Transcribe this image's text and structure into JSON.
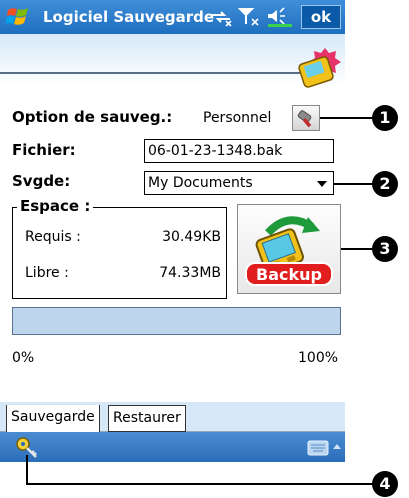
{
  "titlebar": {
    "title": "Logiciel Sauvegarde",
    "ok_label": "ok",
    "icons": [
      "windows-start-icon",
      "sync-icon",
      "signal-icon",
      "volume-icon"
    ]
  },
  "form": {
    "option_label": "Option de sauveg.:",
    "option_value": "Personnel",
    "file_label": "Fichier:",
    "file_value": "06-01-23-1348.bak",
    "save_label": "Svgde:",
    "save_value": "My Documents"
  },
  "space": {
    "title": "Espace :",
    "required_label": "Requis :",
    "required_value": "30.49KB",
    "free_label": "Libre :",
    "free_value": "74.33MB"
  },
  "backup_button": {
    "label": "Backup"
  },
  "progress": {
    "min_label": "0%",
    "max_label": "100%",
    "value_percent": 0
  },
  "tabs": [
    {
      "label": "Sauvegarde",
      "active": true
    },
    {
      "label": "Restaurer",
      "active": false
    }
  ],
  "callouts": [
    "1",
    "2",
    "3",
    "4"
  ],
  "colors": {
    "titlebar": "#1f6fc0",
    "tab_strip": "#d6e8f8",
    "progress_track": "#bdd6ee"
  }
}
